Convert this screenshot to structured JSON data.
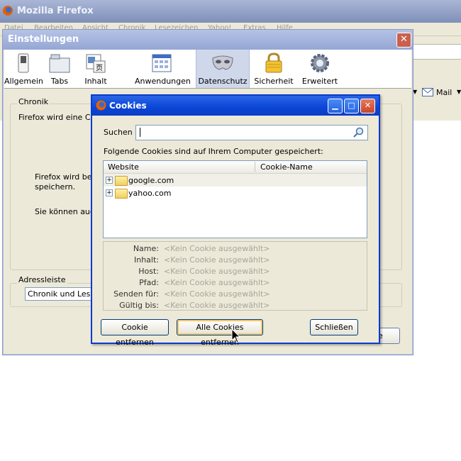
{
  "firefox": {
    "title": "Mozilla Firefox",
    "menu": [
      "Datei",
      "Bearbeiten",
      "Ansicht",
      "Chronik",
      "Lesezeichen",
      "Yahoo!",
      "Extras",
      "Hilfe"
    ],
    "mail_label": "Mail"
  },
  "prefs": {
    "title": "Einstellungen",
    "tabs": [
      {
        "label": "Allgemein",
        "icon": "switch-icon"
      },
      {
        "label": "Tabs",
        "icon": "tabs-icon"
      },
      {
        "label": "Inhalt",
        "icon": "content-icon"
      },
      {
        "label": "Anwendungen",
        "icon": "applications-icon"
      },
      {
        "label": "Datenschutz",
        "icon": "mask-icon"
      },
      {
        "label": "Sicherheit",
        "icon": "lock-icon"
      },
      {
        "label": "Erweitert",
        "icon": "gear-icon"
      }
    ],
    "selected_tab": "Datenschutz",
    "chronik_group": "Chronik",
    "chronik_text1": "Firefox wird eine Chro",
    "chronik_text2a": "Firefox wird besu",
    "chronik_text2b": "speichern.",
    "chronik_text3": "Sie können auch",
    "adressleiste_group": "Adressleiste",
    "adressleiste_value": "Chronik und Leseze",
    "partial_button": "e"
  },
  "cookies": {
    "title": "Cookies",
    "search_label": "Suchen",
    "search_value": "",
    "list_caption": "Folgende Cookies sind auf Ihrem Computer gespeichert:",
    "columns": [
      "Website",
      "Cookie-Name"
    ],
    "sites": [
      "google.com",
      "yahoo.com"
    ],
    "details": {
      "labels": [
        "Name:",
        "Inhalt:",
        "Host:",
        "Pfad:",
        "Senden für:",
        "Gültig bis:"
      ],
      "placeholder": "<Kein Cookie ausgewählt>"
    },
    "buttons": {
      "remove": "Cookie entfernen",
      "remove_all": "Alle Cookies entfernen",
      "close": "Schließen"
    }
  }
}
